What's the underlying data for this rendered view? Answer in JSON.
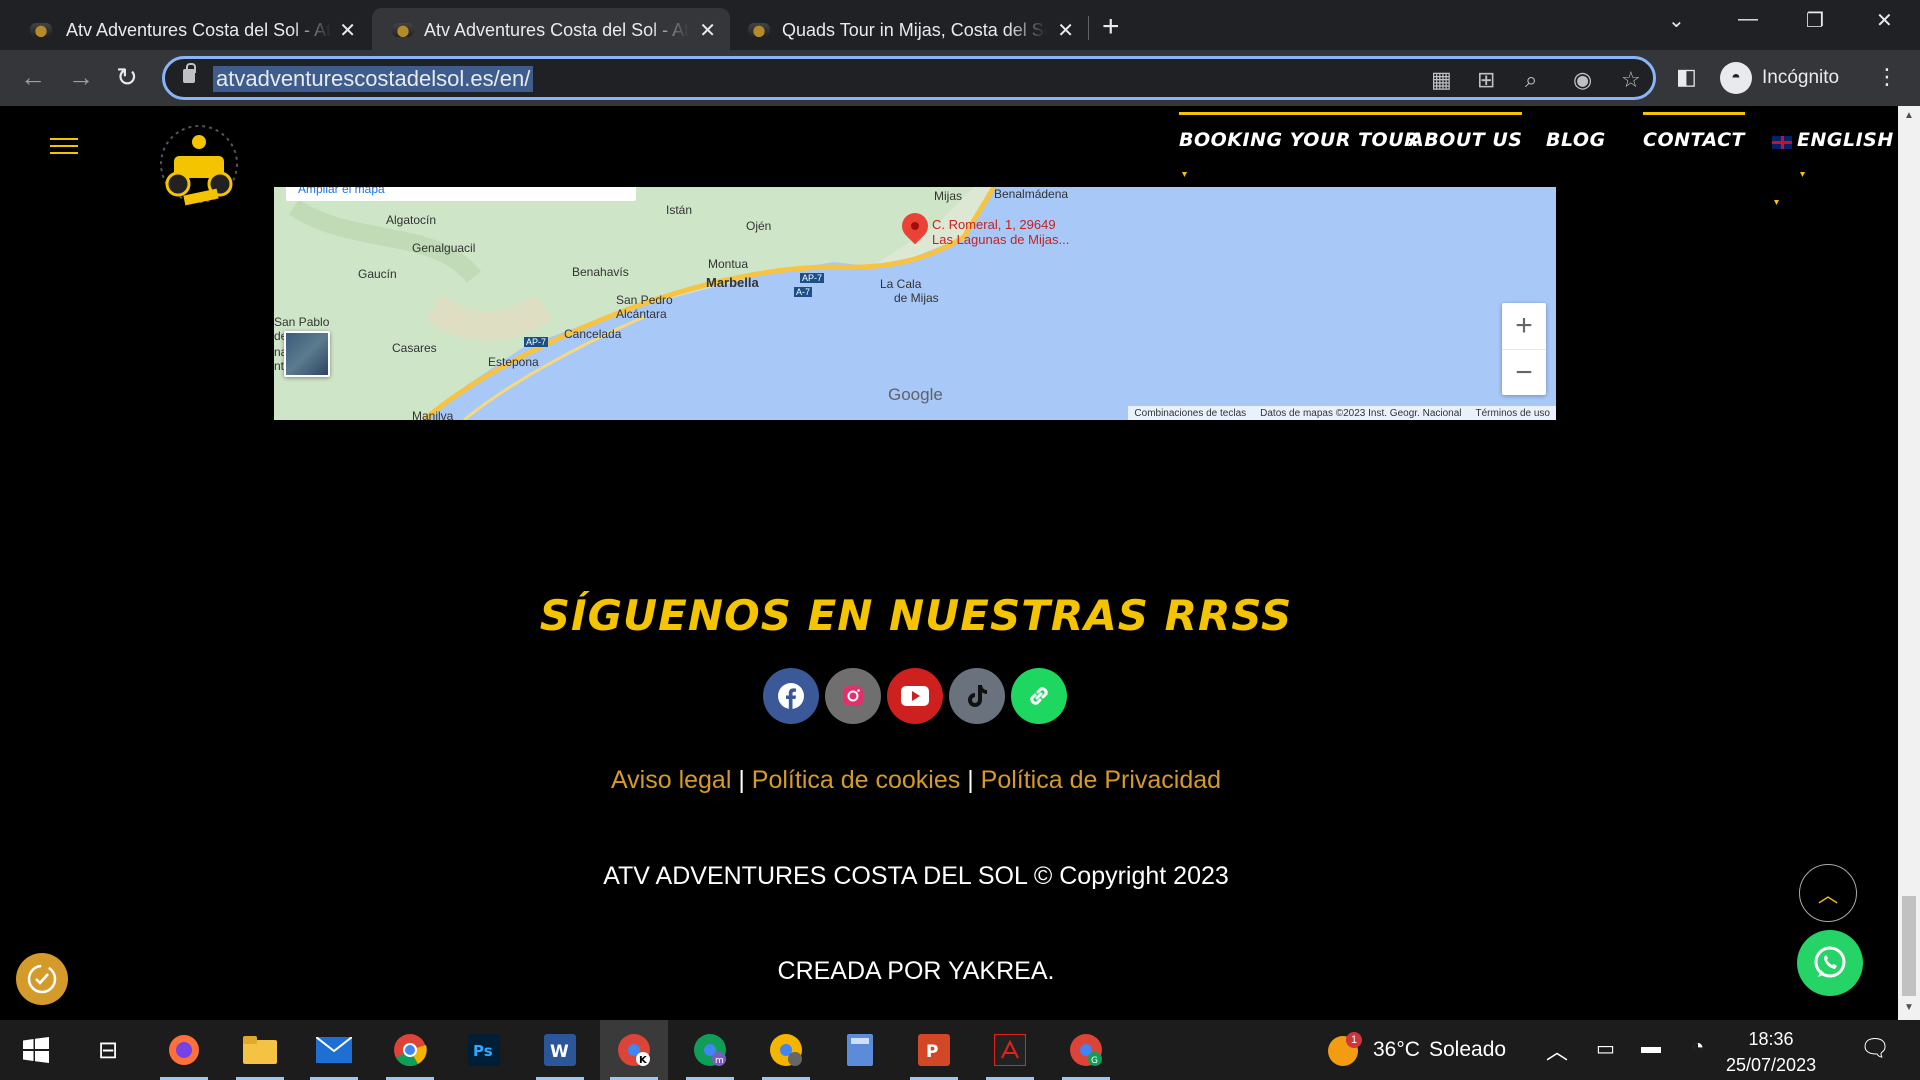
{
  "browser": {
    "tabs": [
      {
        "title": "Atv Adventures Costa del Sol - Atv"
      },
      {
        "title": "Atv Adventures Costa del Sol - Atv"
      },
      {
        "title": "Quads Tour in Mijas, Costa del Sol"
      }
    ],
    "url": "atvadventurescostadelsol.es/en/",
    "profile_label": "Incógnito"
  },
  "nav": {
    "items": [
      "BOOKING YOUR TOUR",
      "ABOUT US",
      "BLOG",
      "CONTACT",
      "ENGLISH"
    ]
  },
  "map": {
    "enlarge_label": "Ampliar el mapa",
    "marker_line1": "C. Romeral, 1, 29649",
    "marker_line2": "Las Lagunas de Mijas...",
    "labels": [
      "Mijas",
      "Benalmádena",
      "Algatocín",
      "Istán",
      "Ojén",
      "Genalguacil",
      "Gaucín",
      "Benahavís",
      "Montua",
      "Marbella",
      "AP-7",
      "A-7",
      "La Cala",
      "de Mijas",
      "San Pedro",
      "Alcántara",
      "San Pablo",
      "de Buceite",
      "na de",
      "nt",
      "AP-7",
      "Cancelada",
      "Casares",
      "Estepona",
      "Manilva"
    ],
    "google": "Google",
    "attribution": [
      "Combinaciones de teclas",
      "Datos de mapas ©2023 Inst. Geogr. Nacional",
      "Términos de uso"
    ],
    "zoom_in": "+",
    "zoom_out": "−"
  },
  "footer": {
    "follow_title": "SÍGUENOS EN NUESTRAS RRSS",
    "social": [
      {
        "name": "facebook",
        "color": "#3b5998"
      },
      {
        "name": "instagram",
        "color": "#6f6f6f"
      },
      {
        "name": "youtube",
        "color": "#cd201f"
      },
      {
        "name": "tiktok",
        "color": "#69727d"
      },
      {
        "name": "link",
        "color": "#1ed760"
      }
    ],
    "legal_links": [
      "Aviso legal",
      "Política de cookies",
      "Política de Privacidad"
    ],
    "separator": "|",
    "copyright": "ATV ADVENTURES COSTA DEL SOL © Copyright 2023",
    "credit": "CREADA POR YAKREA."
  },
  "taskbar": {
    "weather_temp": "36°C",
    "weather_text": "Soleado",
    "weather_badge": "1",
    "time": "18:36",
    "date": "25/07/2023"
  },
  "colors": {
    "accent": "#f5c400",
    "link": "#d49a2a",
    "whatsapp": "#25d366"
  }
}
